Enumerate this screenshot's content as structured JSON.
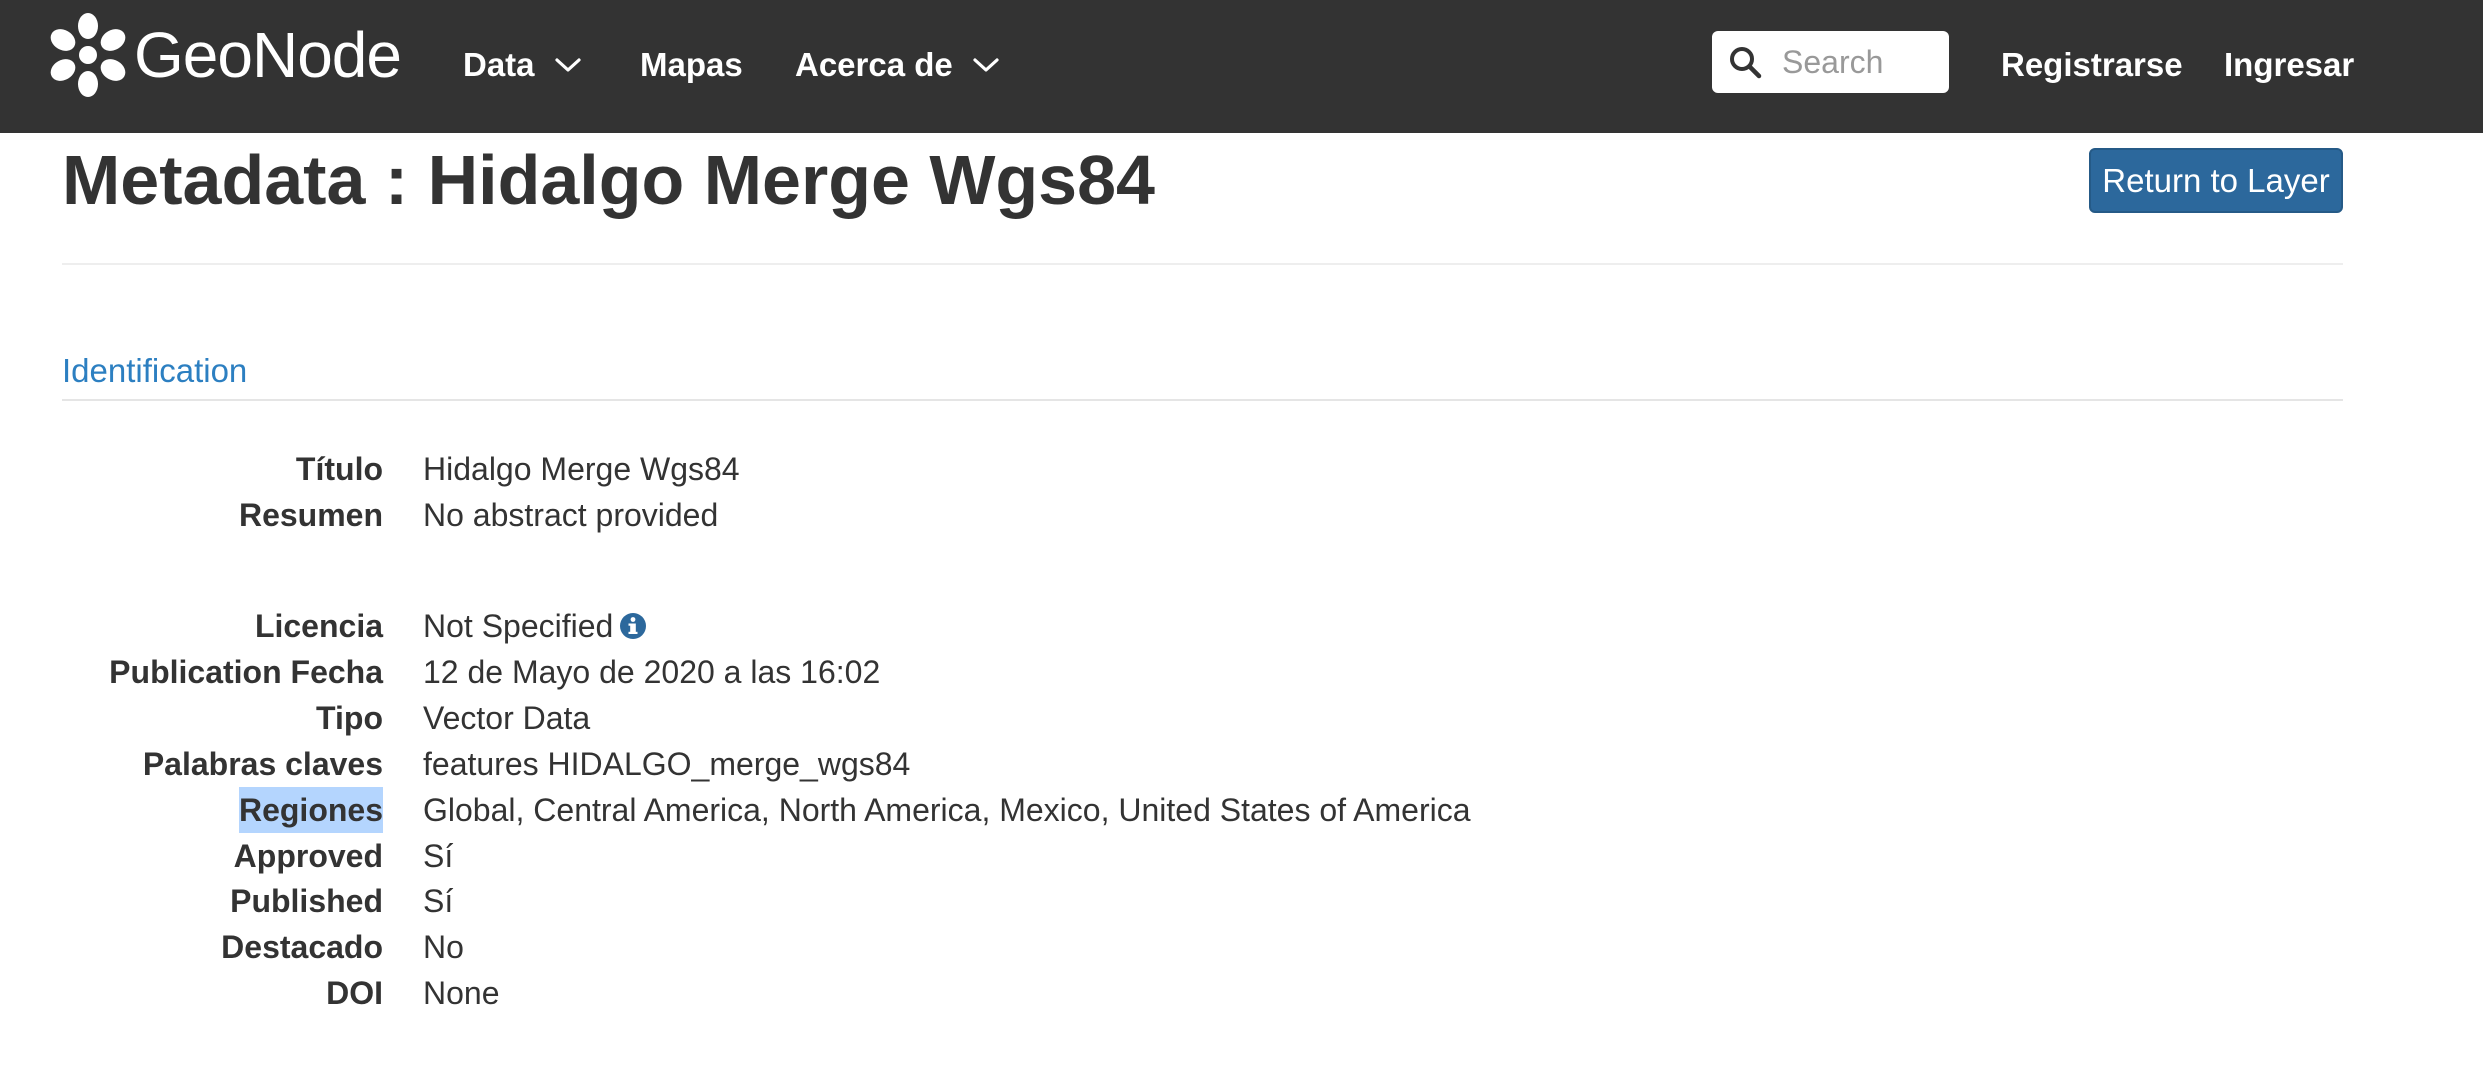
{
  "navbar": {
    "brand": "GeoNode",
    "items": [
      {
        "label": "Data",
        "has_dropdown": true
      },
      {
        "label": "Mapas",
        "has_dropdown": false
      },
      {
        "label": "Acerca de",
        "has_dropdown": true
      }
    ],
    "search": {
      "placeholder": "Search",
      "value": ""
    },
    "register_label": "Registrarse",
    "login_label": "Ingresar"
  },
  "header": {
    "title": "Metadata : Hidalgo Merge Wgs84",
    "return_button_label": "Return to Layer"
  },
  "section": {
    "title": "Identification"
  },
  "metadata": [
    {
      "label": "Título",
      "value": "Hidalgo Merge Wgs84"
    },
    {
      "label": "Resumen",
      "value": "No abstract provided"
    },
    {
      "label": "Licencia",
      "value": "Not Specified",
      "info_icon": "info-circle-icon"
    },
    {
      "label": "Publication Fecha",
      "value": "12 de Mayo de 2020 a las 16:02"
    },
    {
      "label": "Tipo",
      "value": "Vector Data"
    },
    {
      "label": "Palabras claves",
      "value": "features HIDALGO_merge_wgs84"
    },
    {
      "label": "Regiones",
      "value": "Global, Central America, North America, Mexico, United States of America",
      "label_selected": true
    },
    {
      "label": "Approved",
      "value": "Sí"
    },
    {
      "label": "Published",
      "value": "Sí"
    },
    {
      "label": "Destacado",
      "value": "No"
    },
    {
      "label": "DOI",
      "value": "None"
    }
  ],
  "colors": {
    "navbar_bg": "#333333",
    "link": "#2c7fc1",
    "primary_button": "#2c689c",
    "selection_highlight": "#b4d5fe",
    "info_icon": "#2c689c"
  }
}
